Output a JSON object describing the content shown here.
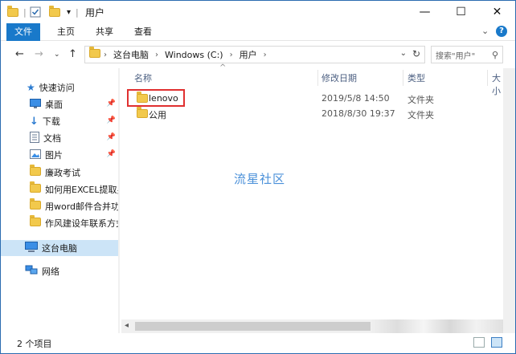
{
  "window": {
    "title": "用户",
    "controls": {
      "minimize": "—",
      "maximize": "☐",
      "close": "✕"
    }
  },
  "ribbon": {
    "tabs": [
      "文件",
      "主页",
      "共享",
      "查看"
    ],
    "expand": "⌄",
    "help": "?"
  },
  "address": {
    "crumbs": [
      "这台电脑",
      "Windows (C:)",
      "用户"
    ],
    "search_placeholder": "搜索\"用户\""
  },
  "sidebar": {
    "quick_access": "快速访问",
    "pinned": [
      {
        "label": "桌面",
        "icon": "desktop-icon"
      },
      {
        "label": "下载",
        "icon": "download-icon"
      },
      {
        "label": "文档",
        "icon": "document-icon"
      },
      {
        "label": "图片",
        "icon": "picture-icon"
      }
    ],
    "recent": [
      "廉政考试",
      "如何用EXCEL提取身",
      "用word邮件合并功",
      "作风建设年联系方式"
    ],
    "this_pc": "这台电脑",
    "network": "网络"
  },
  "columns": {
    "name": "名称",
    "date": "修改日期",
    "type": "类型",
    "size": "大小"
  },
  "files": [
    {
      "name": "lenovo",
      "date": "2019/5/8 14:50",
      "type": "文件夹"
    },
    {
      "name": "公用",
      "date": "2018/8/30 19:37",
      "type": "文件夹"
    }
  ],
  "watermark": "流星社区",
  "status": {
    "count": "2 个项目"
  }
}
